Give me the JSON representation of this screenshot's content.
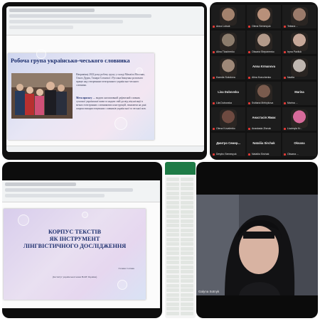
{
  "top_left": {
    "slide": {
      "title": "Робоча група українсько-чеського словника",
      "paragraph1": "Наприкінці 2022 року робочу групу у складі Михаїла Мосенко, Ольги Дудик, Тамари Сотничої і Руслана Іващенка розпочато працю над створенням електронного українсько-чеського словника.",
      "paragraph2_label": "Мета проєкту",
      "paragraph2": " — видати англомовний дефектний словник сучасної української мови та надати свій досвід візуалізації в межах електронних словникових конструкцій, зважаючи на дані широко використовуваних словників української та чеської мов."
    }
  },
  "zoom_grid": {
    "tiles": [
      {
        "name": "Anna Lutsak",
        "tone": "#a3826d",
        "kind": "face"
      },
      {
        "name": "Olena Semesyuk",
        "tone": "#b8907a",
        "kind": "face"
      },
      {
        "name": "Tetiana ...",
        "tone": "#9a7a6a",
        "kind": "face"
      },
      {
        "name": "Alina Tkachenko",
        "tone": "#8c7c6c",
        "kind": "face"
      },
      {
        "name": "Oksana Stepanenko",
        "tone": "#b39a8a",
        "kind": "face"
      },
      {
        "name": "Iryna Pavliuk",
        "tone": "#c7a899",
        "kind": "face"
      },
      {
        "name": "Kseniia Sokolova",
        "tone": "#9e8878",
        "kind": "face"
      },
      {
        "name": "Alina Kravchenko",
        "center": "Anna Krmanova",
        "kind": "label"
      },
      {
        "name": "Nadiia",
        "tone": "#bfb6b0",
        "kind": "face"
      },
      {
        "name": "Liia Dubovska",
        "center": "Lisa Dubovska",
        "kind": "label"
      },
      {
        "name": "Svitlana Melnykova",
        "tone": "#7a5b4d",
        "kind": "face"
      },
      {
        "name": "Marina ...",
        "center": "Marina",
        "kind": "label"
      },
      {
        "name": "Olena Kovalenko",
        "tone": "#6e4a40",
        "kind": "face"
      },
      {
        "name": "Anastasia Zhmak",
        "center": "Анастасія Жмак",
        "kind": "label"
      },
      {
        "name": "Liudmyla Kr...",
        "tone": "#d86a9a",
        "kind": "face"
      },
      {
        "name": "Dmytro Semesyuk",
        "center": "Дмитро Семер...",
        "kind": "label"
      },
      {
        "name": "Nataliia Sirchak",
        "center": "Nataliia Sirchak",
        "kind": "label"
      },
      {
        "name": "Oksana ...",
        "center": "Oksana",
        "kind": "label"
      }
    ]
  },
  "bottom_left": {
    "slide": {
      "title_line1": "КОРПУС ТЕКСТІВ",
      "title_line2": "ЯК ІНСТРУМЕНТ",
      "title_line3": "ЛІНГВІСТИЧНОГО ДОСЛІДЖЕННЯ",
      "author": "Галина Сотник",
      "affiliation": "(Інститут української мови НАН України)"
    }
  },
  "bottom_right": {
    "speaker_name": "Galyna Sotnyk"
  },
  "colors": {
    "slide_title": "#1d2f6e",
    "mic_muted": "#e53935"
  }
}
